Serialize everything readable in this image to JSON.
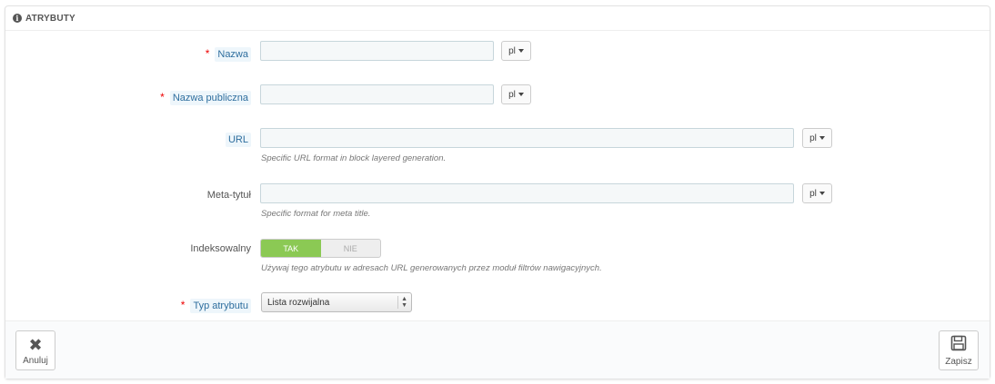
{
  "panel": {
    "title": "ATRYBUTY",
    "icon": "info-icon"
  },
  "form": {
    "name": {
      "label": "Nazwa",
      "value": "",
      "lang": "pl"
    },
    "public_name": {
      "label": "Nazwa publiczna",
      "value": "",
      "lang": "pl"
    },
    "url": {
      "label": "URL",
      "value": "",
      "lang": "pl",
      "help": "Specific URL format in block layered generation."
    },
    "meta_title": {
      "label": "Meta-tytuł",
      "value": "",
      "lang": "pl",
      "help": "Specific format for meta title."
    },
    "indexable": {
      "label": "Indeksowalny",
      "on_label": "TAK",
      "off_label": "NIE",
      "selected": "TAK",
      "help": "Używaj tego atrybutu w adresach URL generowanych przez moduł filtrów nawigacyjnych."
    },
    "attr_type": {
      "label": "Typ atrybutu",
      "value": "Lista rozwijalna"
    },
    "required_mark": "*"
  },
  "footer": {
    "cancel_label": "Anuluj",
    "save_label": "Zapisz"
  },
  "colors": {
    "accent_green": "#8bc954",
    "required_red": "#e00000",
    "hint_blue": "#2e6e9e"
  }
}
